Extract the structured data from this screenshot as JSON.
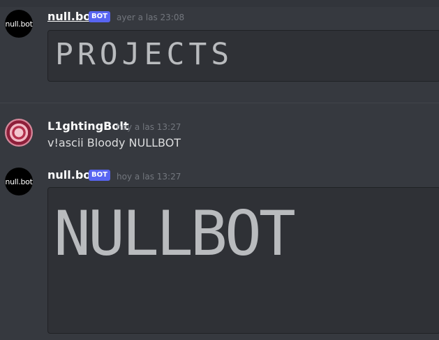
{
  "messages": [
    {
      "author": "null.bot",
      "avatar_text": "null.bot",
      "bot_tag": "BOT",
      "timestamp": "ayer a las 23:08",
      "ascii_text": "PROJECTS"
    },
    {
      "author": "L1ghtingBolt",
      "timestamp": "hoy a las 13:27",
      "text": "v!ascii Bloody NULLBOT"
    },
    {
      "author": "null.bot",
      "avatar_text": "null.bot",
      "bot_tag": "BOT",
      "timestamp": "hoy a las 13:27",
      "ascii_text": "NULLBOT"
    }
  ],
  "colors": {
    "background": "#36393f",
    "codeblock": "#2f3136",
    "bot_tag": "#5865f2",
    "timestamp": "#72767d"
  }
}
